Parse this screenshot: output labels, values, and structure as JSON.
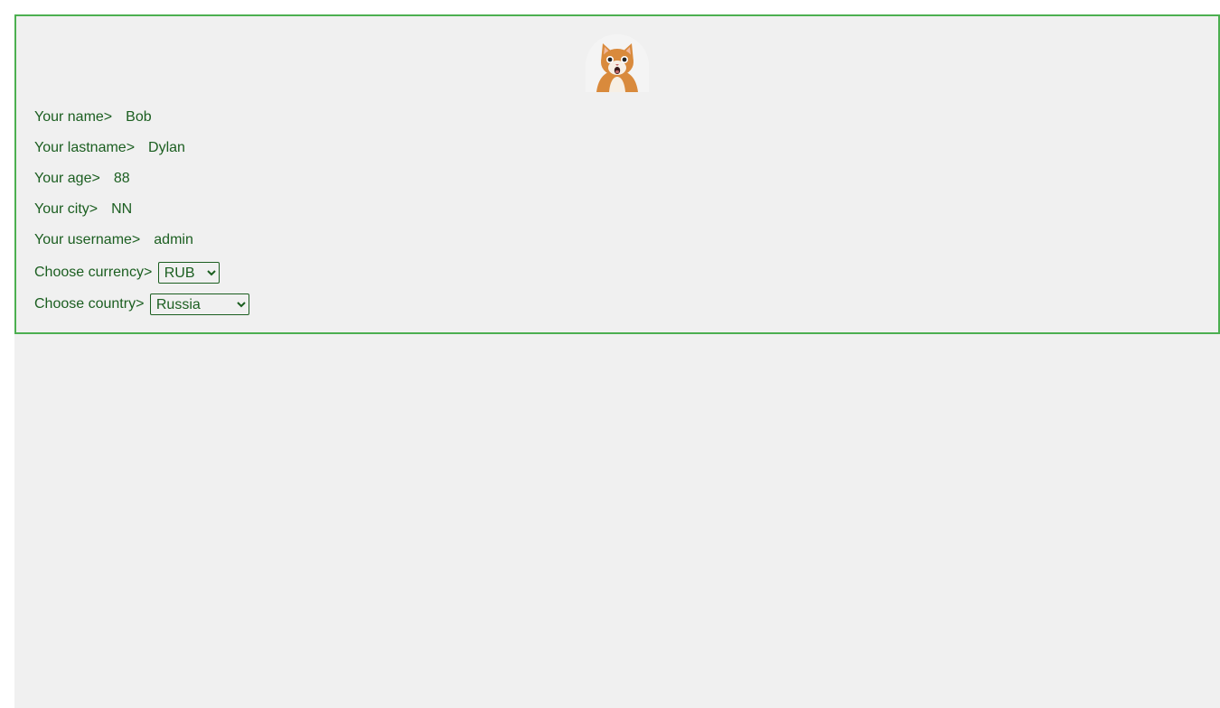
{
  "profile": {
    "avatar_icon": "cat-avatar-icon",
    "fields": [
      {
        "label": "Your name>",
        "value": "Bob"
      },
      {
        "label": "Your lastname>",
        "value": "Dylan"
      },
      {
        "label": "Your age>",
        "value": "88"
      },
      {
        "label": "Your city>",
        "value": "NN"
      },
      {
        "label": "Your username>",
        "value": "admin"
      }
    ],
    "currency": {
      "label": "Choose currency>",
      "selected": "RUB"
    },
    "country": {
      "label": "Choose country>",
      "selected": "Russia"
    }
  },
  "colors": {
    "border": "#4caf50",
    "text": "#1b5e20",
    "background": "#f0f0f0"
  }
}
